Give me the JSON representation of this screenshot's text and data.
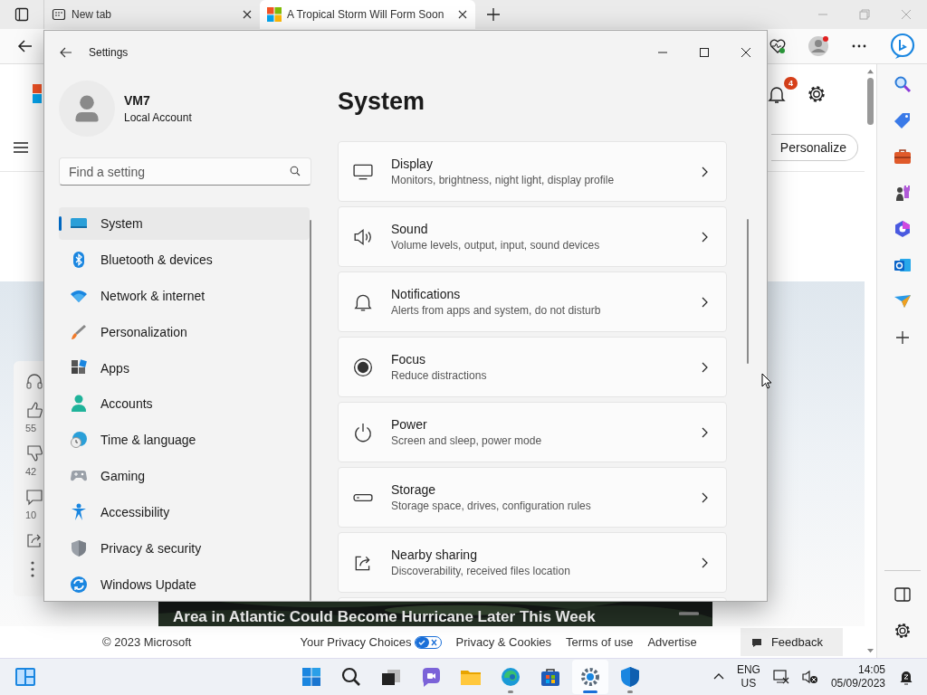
{
  "browser": {
    "tabs": [
      {
        "title": "New tab",
        "selected": false
      },
      {
        "title": "A Tropical Storm Will Form Soon",
        "selected": true
      }
    ]
  },
  "page": {
    "notification_count": "4",
    "personalize_button": "Personalize",
    "reaction_counts": [
      "55",
      "42",
      "10"
    ],
    "headline": "Area in Atlantic Could Become Hurricane Later This Week",
    "footer": {
      "copyright": "© 2023 Microsoft",
      "links": [
        "Your Privacy Choices",
        "Privacy & Cookies",
        "Terms of use",
        "Advertise"
      ]
    },
    "feedback_button": "Feedback"
  },
  "settings": {
    "title": "Settings",
    "user": {
      "name": "VM7",
      "account_type": "Local Account"
    },
    "search": {
      "placeholder": "Find a setting"
    },
    "nav": [
      {
        "label": "System",
        "selected": true
      },
      {
        "label": "Bluetooth & devices",
        "selected": false
      },
      {
        "label": "Network & internet",
        "selected": false
      },
      {
        "label": "Personalization",
        "selected": false
      },
      {
        "label": "Apps",
        "selected": false
      },
      {
        "label": "Accounts",
        "selected": false
      },
      {
        "label": "Time & language",
        "selected": false
      },
      {
        "label": "Gaming",
        "selected": false
      },
      {
        "label": "Accessibility",
        "selected": false
      },
      {
        "label": "Privacy & security",
        "selected": false
      },
      {
        "label": "Windows Update",
        "selected": false
      }
    ],
    "heading": "System",
    "cards": [
      {
        "title": "Display",
        "description": "Monitors, brightness, night light, display profile"
      },
      {
        "title": "Sound",
        "description": "Volume levels, output, input, sound devices"
      },
      {
        "title": "Notifications",
        "description": "Alerts from apps and system, do not disturb"
      },
      {
        "title": "Focus",
        "description": "Reduce distractions"
      },
      {
        "title": "Power",
        "description": "Screen and sleep, power mode"
      },
      {
        "title": "Storage",
        "description": "Storage space, drives, configuration rules"
      },
      {
        "title": "Nearby sharing",
        "description": "Discoverability, received files location"
      }
    ]
  },
  "taskbar": {
    "apps": [
      {
        "selected": false,
        "running": false
      },
      {
        "selected": false,
        "running": false
      },
      {
        "selected": false,
        "running": false
      },
      {
        "selected": false,
        "running": false
      },
      {
        "selected": false,
        "running": false
      },
      {
        "selected": false,
        "running": true
      },
      {
        "selected": false,
        "running": false
      },
      {
        "selected": true,
        "running": true
      },
      {
        "selected": false,
        "running": true
      }
    ],
    "language": "ENG",
    "region": "US",
    "time": "14:05",
    "date": "05/09/2023"
  }
}
